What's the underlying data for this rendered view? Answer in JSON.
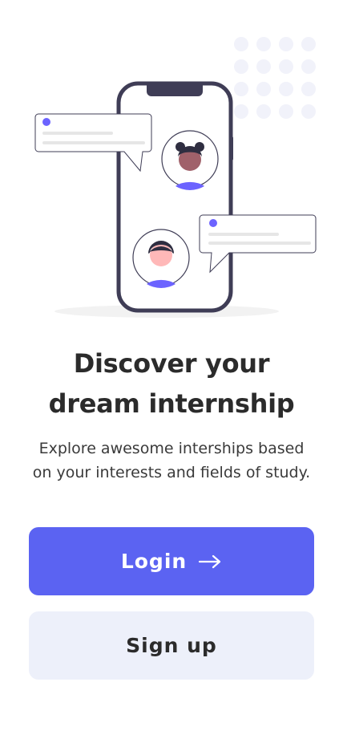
{
  "onboarding": {
    "headline_line1": "Discover your",
    "headline_line2": "dream internship",
    "subtitle_line1": "Explore awesome interships based",
    "subtitle_line2": "on your interests and fields of study.",
    "login_label": "Login",
    "signup_label": "Sign up",
    "login_icon": "arrow-right-icon",
    "illustration_icon": "phone-chat-illustration"
  },
  "colors": {
    "primary": "#5b63f2",
    "primary_light": "#edf0fa",
    "heading_text": "#2b2b2b",
    "body_text": "#3a3a3a",
    "phone_frame": "#3f3d56",
    "decor_dots": "#f1f2fa",
    "accent_dot": "#6c63ff"
  }
}
